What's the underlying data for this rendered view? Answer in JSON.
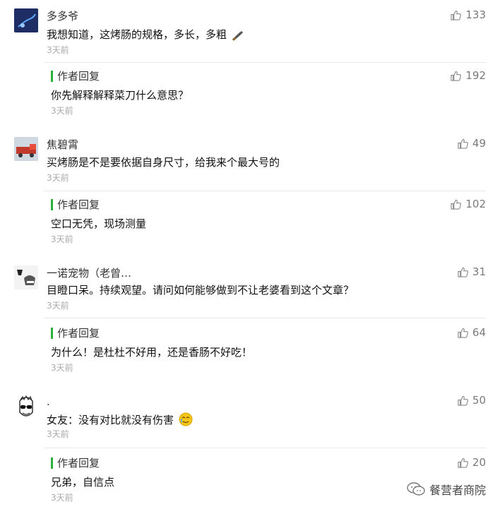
{
  "reply_label": "作者回复",
  "comments": [
    {
      "name": "多多爷",
      "text": "我想知道，这烤肠的规格，多长，多粗",
      "time": "3天前",
      "likes": "133",
      "reply": {
        "text": "你先解释解释菜刀什么意思？",
        "time": "3天前",
        "likes": "192"
      }
    },
    {
      "name": "焦碧霄",
      "text": "买烤肠是不是要依据自身尺寸，给我来个最大号的",
      "time": "3天前",
      "likes": "49",
      "reply": {
        "text": "空口无凭，现场测量",
        "time": "3天前",
        "likes": "102"
      }
    },
    {
      "name": "一诺宠物（老曾…",
      "text": "目瞪口呆。持续观望。请问如何能够做到不让老婆看到这个文章？",
      "time": "3天前",
      "likes": "31",
      "reply": {
        "text": "为什么！是杜杜不好用，还是香肠不好吃！",
        "time": "3天前",
        "likes": "64"
      }
    },
    {
      "name": ".",
      "text": "女友：没有对比就没有伤害",
      "time": "3天前",
      "likes": "50",
      "reply": {
        "text": "兄弟，自信点",
        "time": "3天前",
        "likes": "20"
      }
    }
  ],
  "watermark": "餐营者商院",
  "colors": {
    "accent": "#2aae3c",
    "muted": "#aaaaaa",
    "divider": "#e9e9e9"
  }
}
